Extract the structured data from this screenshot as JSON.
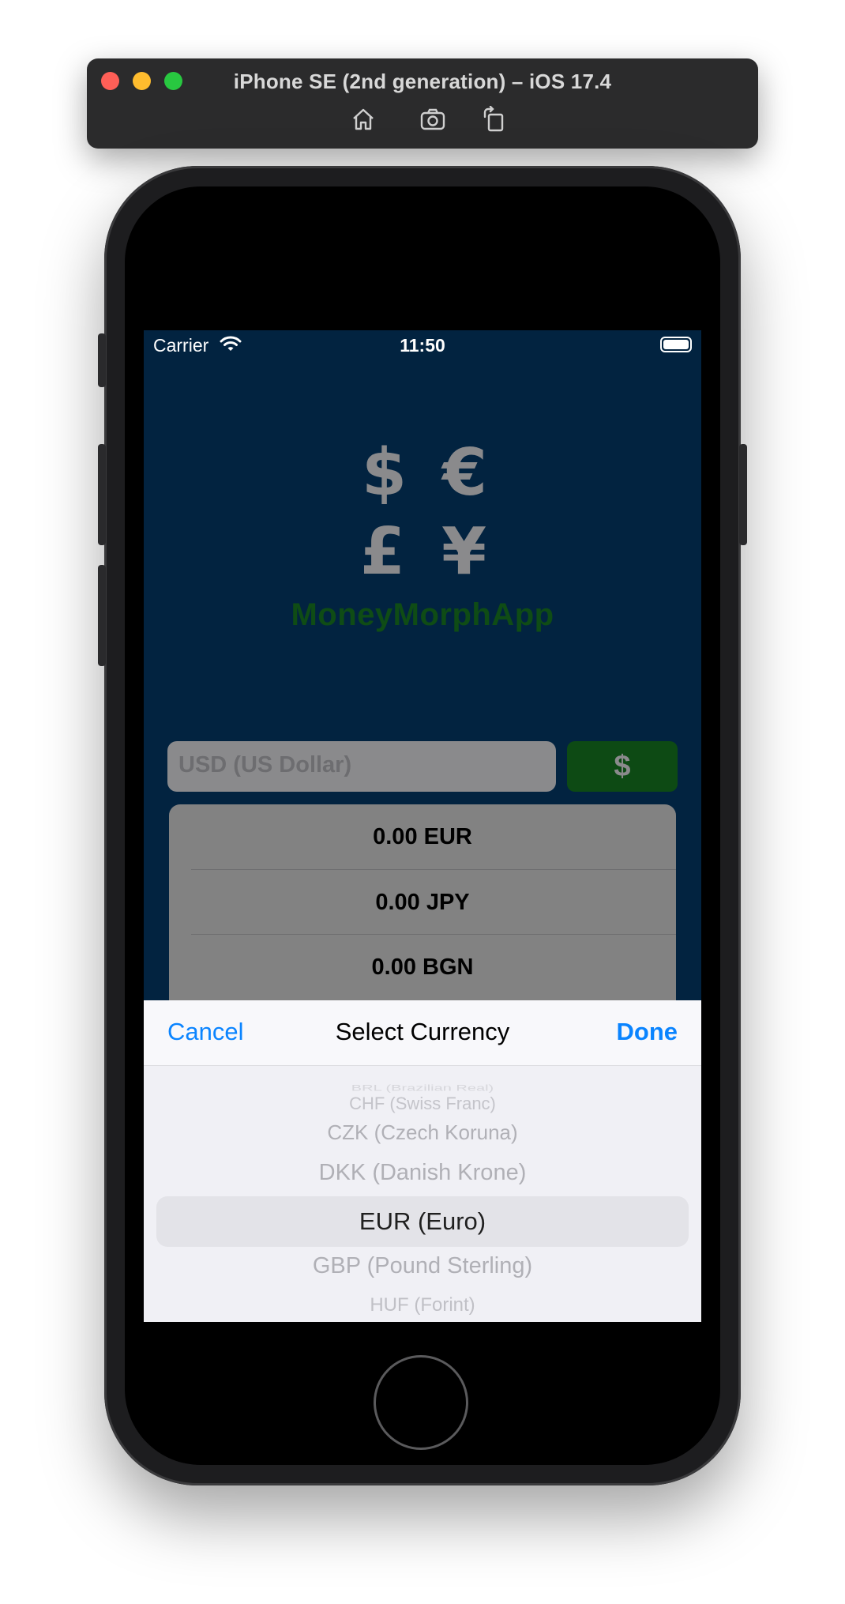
{
  "simulator": {
    "title": "iPhone SE (2nd generation) – iOS 17.4",
    "toolbar_icons": [
      "home-icon",
      "screenshot-icon",
      "rotate-icon"
    ]
  },
  "status_bar": {
    "carrier": "Carrier",
    "time": "11:50"
  },
  "logo": {
    "symbols": [
      "$",
      "€",
      "£",
      "¥"
    ],
    "app_name": "MoneyMorphApp"
  },
  "input": {
    "placeholder": "USD (US Dollar)",
    "symbol_button": "$"
  },
  "results": [
    "0.00 EUR",
    "0.00 JPY",
    "0.00 BGN"
  ],
  "picker_sheet": {
    "cancel_label": "Cancel",
    "title": "Select Currency",
    "done_label": "Done",
    "items": [
      "BRL (Brazilian Real)",
      "CHF (Swiss Franc)",
      "CZK (Czech Koruna)",
      "DKK (Danish Krone)",
      "EUR (Euro)",
      "GBP (Pound Sterling)",
      "HUF (Forint)"
    ],
    "selected": "EUR (Euro)"
  },
  "colors": {
    "screen_background": "#022340",
    "accent_blue": "#0a84ff",
    "app_green": "#0f4c15"
  }
}
